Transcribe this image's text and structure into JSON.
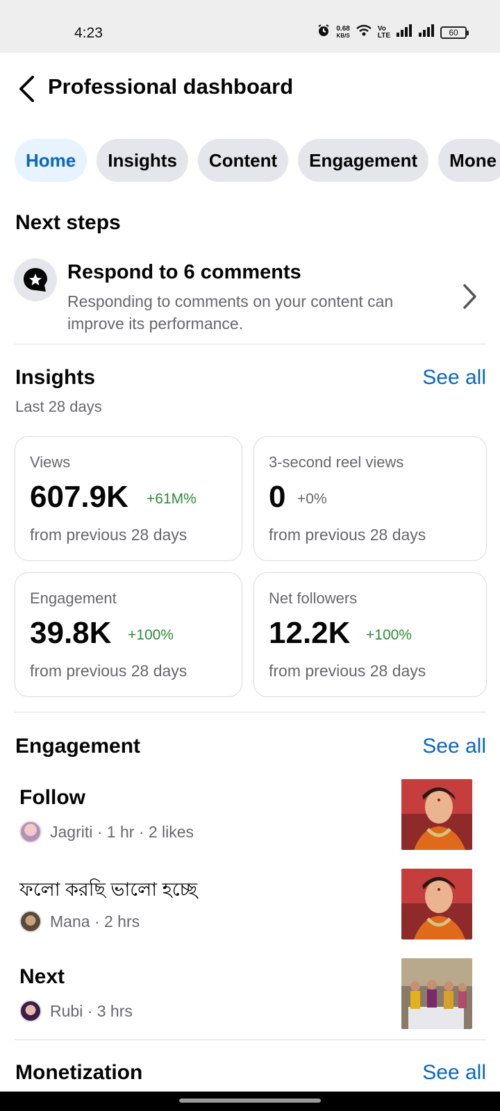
{
  "status_bar": {
    "time": "4:23",
    "net_speed_value": "0.68",
    "net_speed_unit": "KB/S",
    "volte_top": "Vo",
    "volte_bottom": "LTE",
    "battery": "60"
  },
  "header": {
    "title": "Professional dashboard"
  },
  "tabs": [
    {
      "label": "Home",
      "active": true
    },
    {
      "label": "Insights"
    },
    {
      "label": "Content"
    },
    {
      "label": "Engagement"
    },
    {
      "label": "Mone"
    }
  ],
  "next_steps": {
    "title": "Next steps",
    "item": {
      "title": "Respond to 6 comments",
      "description": "Responding to comments on your content can improve its performance."
    }
  },
  "insights": {
    "title": "Insights",
    "see_all": "See all",
    "period": "Last 28 days",
    "cards": [
      {
        "label": "Views",
        "value": "607.9K",
        "change": "+61M%",
        "footer": "from previous 28 days"
      },
      {
        "label": "3-second reel views",
        "value": "0",
        "change": "+0%",
        "footer": "from previous 28 days"
      },
      {
        "label": "Engagement",
        "value": "39.8K",
        "change": "+100%",
        "footer": "from previous 28 days"
      },
      {
        "label": "Net followers",
        "value": "12.2K",
        "change": "+100%",
        "footer": "from previous 28 days"
      }
    ]
  },
  "engagement": {
    "title": "Engagement",
    "see_all": "See all",
    "items": [
      {
        "title": "Follow",
        "meta": "Jagriti · 1 hr · 2 likes"
      },
      {
        "title": "ফলো করছি ভালো হচ্ছে",
        "meta": "Mana · 2 hrs"
      },
      {
        "title": "Next",
        "meta": "Rubi · 3 hrs"
      }
    ]
  },
  "monetization": {
    "title": "Monetization",
    "see_all": "See all"
  },
  "colors": {
    "accent": "#0a66c2",
    "positive": "#2e8b3a",
    "muted": "#65676b"
  }
}
